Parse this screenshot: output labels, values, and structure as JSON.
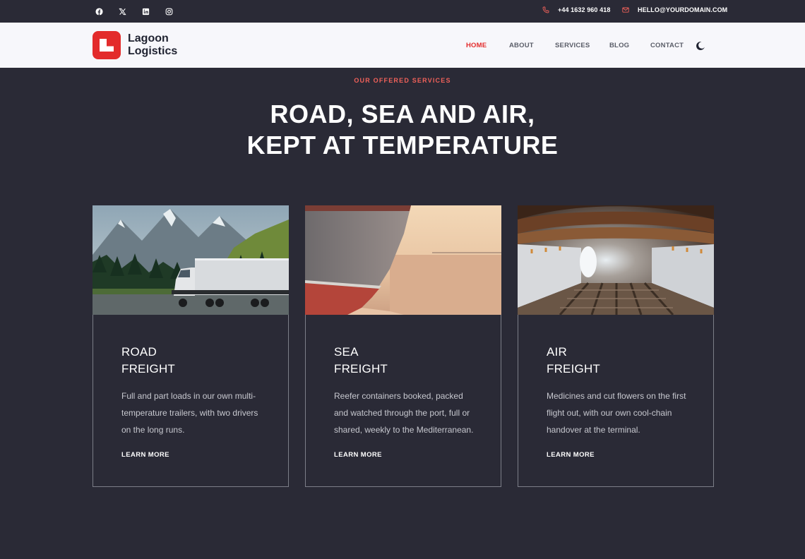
{
  "topbar": {
    "social": [
      "facebook-icon",
      "x-icon",
      "linkedin-icon",
      "instagram-icon"
    ],
    "phone": "+44 1632 960 418",
    "email": "HELLO@YOURDOMAIN.COM"
  },
  "header": {
    "logo_line1": "Lagoon",
    "logo_line2": "Logistics",
    "nav": [
      "HOME",
      "ABOUT",
      "SERVICES",
      "BLOG",
      "CONTACT"
    ],
    "active_nav": "HOME",
    "theme_toggle_icon": "moon-icon"
  },
  "hero": {
    "eyebrow": "OUR OFFERED SERVICES",
    "title_line1": "ROAD, SEA AND AIR,",
    "title_line2": "KEPT AT TEMPERATURE"
  },
  "cards": [
    {
      "title_line1": "ROAD",
      "title_line2": "FREIGHT",
      "description": "Full and part loads in our own multi-temperature trailers, with two drivers on the long runs.",
      "link": "LEARN MORE",
      "image": "truck-mountain-road"
    },
    {
      "title_line1": "SEA",
      "title_line2": "FREIGHT",
      "description": "Reefer containers booked, packed and watched through the port, full or shared, weekly to the Mediterranean.",
      "link": "LEARN MORE",
      "image": "cargo-ship-hull"
    },
    {
      "title_line1": "AIR",
      "title_line2": "FREIGHT",
      "description": "Medicines and cut flowers on the first flight out, with our own cool-chain handover at the terminal.",
      "link": "LEARN MORE",
      "image": "aircraft-cargo-hold"
    }
  ],
  "colors": {
    "accent": "#e32b2b",
    "background": "#2a2a36",
    "header_bg": "#f7f7fb"
  }
}
